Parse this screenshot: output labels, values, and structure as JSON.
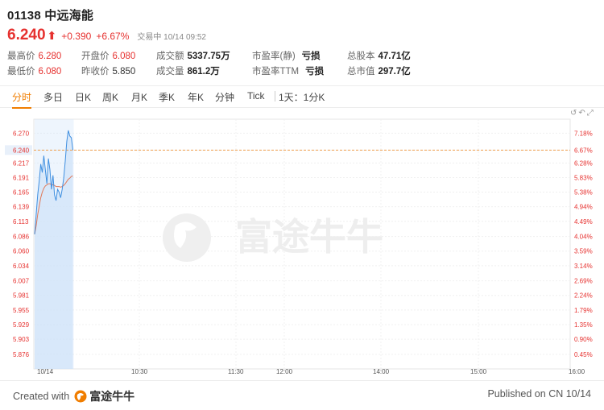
{
  "stock": {
    "ticker": "01138 中远海能",
    "price": "6.240",
    "change": "+0.390",
    "change_pct": "+6.67%",
    "status": "交易中 10/14 09:52"
  },
  "stats": [
    {
      "label": "最高价",
      "value": "6.280"
    },
    {
      "label": "开盘价",
      "value": "6.080"
    },
    {
      "label": "成交额",
      "value": "5337.75万"
    },
    {
      "label": "市盈率(静)",
      "value": "亏损"
    },
    {
      "label": "总股本",
      "value": "47.71亿"
    },
    {
      "label": "最低价",
      "value": "6.080"
    },
    {
      "label": "昨收价",
      "value": "5.850"
    },
    {
      "label": "成交量",
      "value": "861.2万"
    },
    {
      "label": "市盈率TTM",
      "value": "亏损"
    },
    {
      "label": "总市值",
      "value": "297.7亿"
    }
  ],
  "tabs": [
    "分时",
    "多日",
    "日K",
    "周K",
    "月K",
    "季K",
    "年K",
    "分钟",
    "Tick",
    "1天：1分K"
  ],
  "toolbar": {
    "icons": [
      "refresh-icon",
      "undo-icon",
      "fullscreen-icon"
    ]
  },
  "chart_data": {
    "type": "line",
    "y_ticks_left": [
      "6.270",
      "6.240",
      "6.217",
      "6.191",
      "6.165",
      "6.139",
      "6.113",
      "6.086",
      "6.060",
      "6.034",
      "6.007",
      "5.981",
      "5.955",
      "5.929",
      "5.903",
      "5.876"
    ],
    "y_ticks_right": [
      "7.18%",
      "6.67%",
      "6.28%",
      "5.83%",
      "5.38%",
      "4.94%",
      "4.49%",
      "4.04%",
      "3.59%",
      "3.14%",
      "2.69%",
      "2.24%",
      "1.79%",
      "1.35%",
      "0.90%",
      "0.45%"
    ],
    "x_ticks": [
      "10/14",
      "10:30",
      "11:30",
      "12:00",
      "14:00",
      "15:00",
      "16:00"
    ],
    "ylim": [
      5.85,
      6.295
    ],
    "current_price_line": 6.24,
    "price_series": [
      6.09,
      6.125,
      6.16,
      6.185,
      6.215,
      6.2,
      6.23,
      6.205,
      6.18,
      6.225,
      6.205,
      6.17,
      6.195,
      6.16,
      6.15,
      6.17,
      6.165,
      6.155,
      6.17,
      6.19,
      6.22,
      6.255,
      6.275,
      6.265,
      6.262,
      6.24
    ],
    "avg_series": [
      6.09,
      6.105,
      6.125,
      6.14,
      6.155,
      6.165,
      6.172,
      6.176,
      6.178,
      6.18,
      6.18,
      6.178,
      6.178,
      6.177,
      6.175,
      6.175,
      6.175,
      6.174,
      6.175,
      6.177,
      6.18,
      6.184,
      6.188,
      6.19,
      6.193,
      6.194
    ],
    "colors": {
      "price": "#3f8fe0",
      "avg": "#e07a5a",
      "fill": "#cfe2f8",
      "ref_line": "#f0a050",
      "up": "#e6312f",
      "down": "#2ca05a"
    }
  },
  "watermark": "富途牛牛",
  "footer": {
    "created_label": "Created with",
    "brand": "富途牛牛",
    "published": "Published on CN 10/14"
  }
}
